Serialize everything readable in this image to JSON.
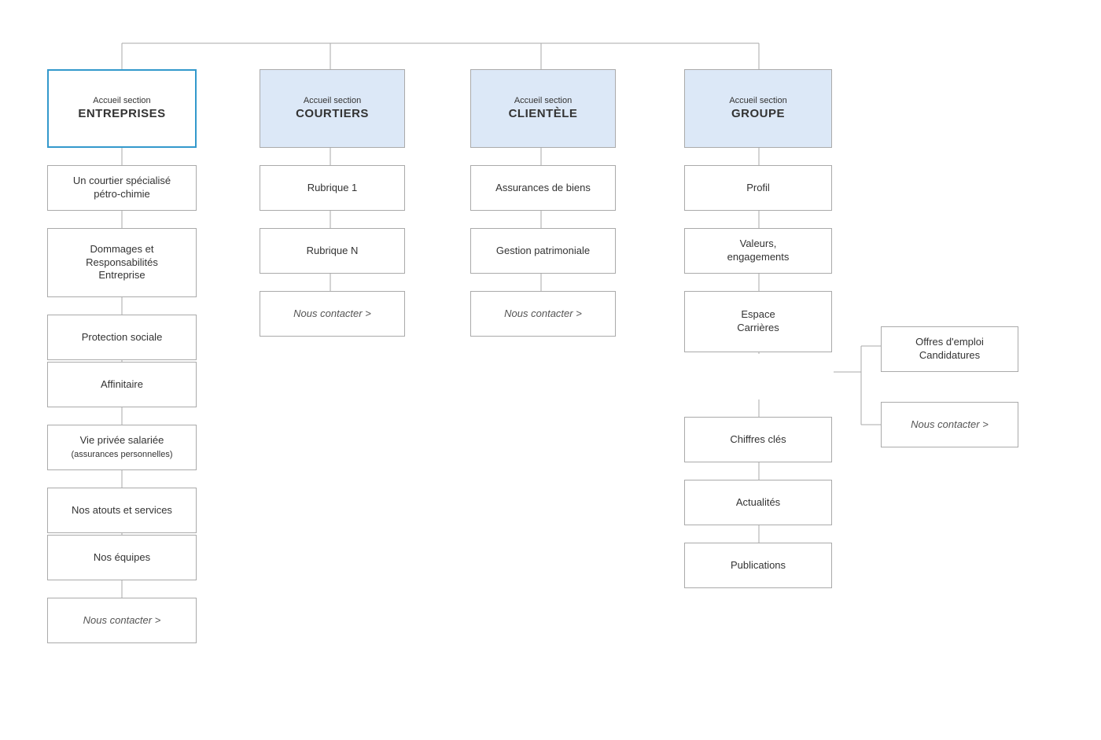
{
  "sections": {
    "entreprises": {
      "header": {
        "sub": "Accueil section",
        "main": "ENTREPRISES"
      },
      "items": [
        "Un courtier spécialisé pétro-chimie",
        "Dommages et\nResponsabilités\nEntreprise",
        "Protection sociale",
        "Affinitaire",
        "Vie privée salariée\n(assurances personnelles)",
        "Nos atouts et services",
        "Nos équipes",
        "Nous contacter >"
      ]
    },
    "courtiers": {
      "header": {
        "sub": "Accueil section",
        "main": "COURTIERS"
      },
      "items": [
        "Rubrique 1",
        "Rubrique N",
        "Nous contacter >"
      ]
    },
    "clientele": {
      "header": {
        "sub": "Accueil section",
        "main": "CLIENTÈLE"
      },
      "items": [
        "Assurances de biens",
        "Gestion patrimoniale",
        "Nous contacter >"
      ]
    },
    "groupe": {
      "header": {
        "sub": "Accueil section",
        "main": "GROUPE"
      },
      "items": [
        "Profil",
        "Valeurs,\nengagements",
        "Espace\nCarrières",
        "Chiffres clés",
        "Actualités",
        "Publications"
      ],
      "carriere_sub": [
        "Offres d'emploi\nCandidatures",
        "Nous contacter >"
      ]
    }
  }
}
